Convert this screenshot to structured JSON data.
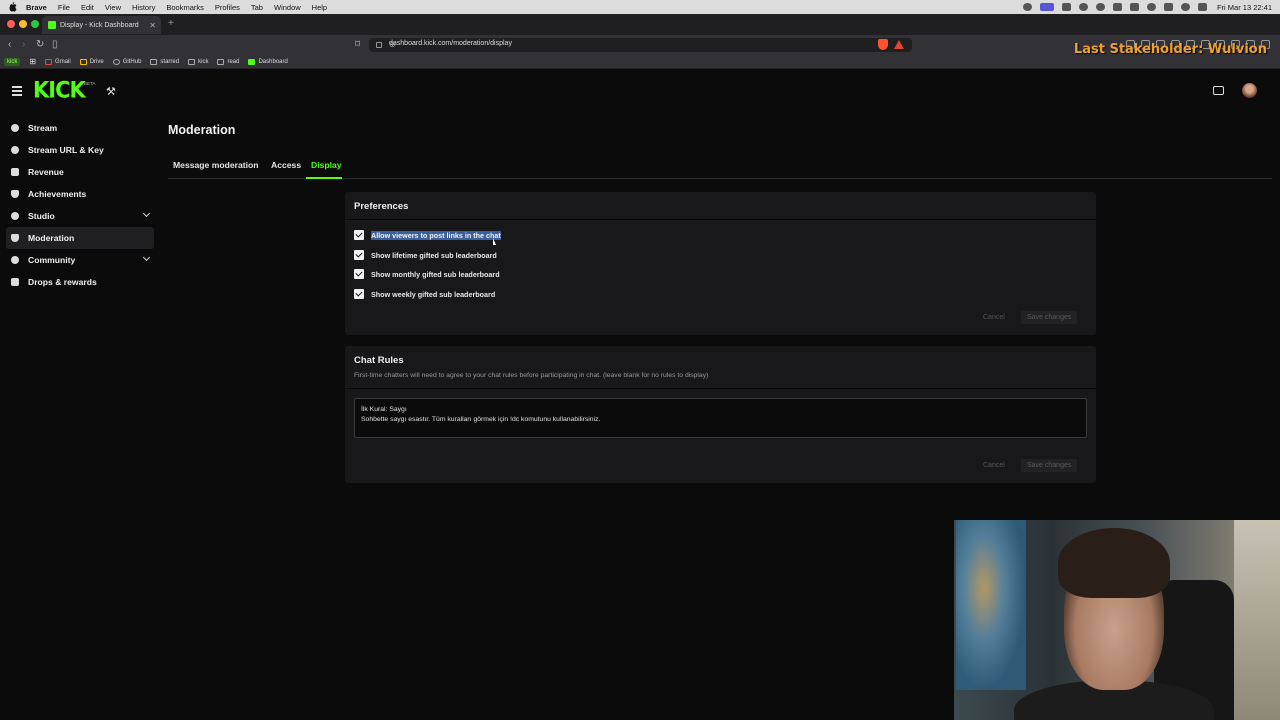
{
  "macos_menu": {
    "app": "Brave",
    "items": [
      "File",
      "Edit",
      "View",
      "History",
      "Bookmarks",
      "Profiles",
      "Tab",
      "Window",
      "Help"
    ],
    "clock": "Fri Mar 13  22:41"
  },
  "browser": {
    "tab_title": "Display - Kick Dashboard",
    "url": "dashboard.kick.com/moderation/display",
    "bookmarks": [
      "kick",
      "Gmail",
      "Drive",
      "GitHub",
      "starred",
      "kick",
      "read",
      "Dashboard"
    ]
  },
  "overlay": {
    "text": "Last Stakeholder: Wulvion",
    "color": "#f0a030"
  },
  "header": {
    "logo": "KICK",
    "beta": "BETA"
  },
  "sidebar": {
    "items": [
      {
        "label": "Stream",
        "icon": "broadcast-icon"
      },
      {
        "label": "Stream URL & Key",
        "icon": "link-icon"
      },
      {
        "label": "Revenue",
        "icon": "revenue-icon"
      },
      {
        "label": "Achievements",
        "icon": "trophy-icon"
      },
      {
        "label": "Studio",
        "icon": "studio-icon"
      },
      {
        "label": "Moderation",
        "icon": "shield-icon"
      },
      {
        "label": "Community",
        "icon": "community-icon"
      },
      {
        "label": "Drops & rewards",
        "icon": "gift-icon"
      }
    ]
  },
  "main": {
    "title": "Moderation",
    "tabs": [
      "Message moderation",
      "Access",
      "Display"
    ],
    "active_tab": "Display",
    "accent": "#53fc18"
  },
  "preferences": {
    "title": "Preferences",
    "options": [
      "Allow viewers to post links in the chat",
      "Show lifetime gifted sub leaderboard",
      "Show monthly gifted sub leaderboard",
      "Show weekly gifted sub leaderboard"
    ],
    "checked": [
      true,
      true,
      true,
      true
    ],
    "cancel": "Cancel",
    "save": "Save changes"
  },
  "chat_rules": {
    "title": "Chat Rules",
    "description": "First-time chatters will need to agree to your chat rules before participating in chat. (leave blank for no rules to display)",
    "value": "İlk Kural: Saygı\nSohbette saygı esastır. Tüm kuralları görmek için !dc komutunu kullanabilirsiniz.",
    "cancel": "Cancel",
    "save": "Save changes"
  }
}
